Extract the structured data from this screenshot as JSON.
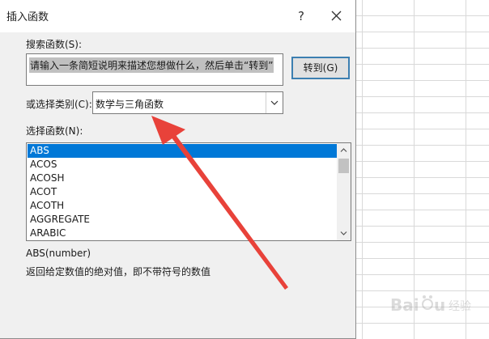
{
  "dialog": {
    "title": "插入函数",
    "help_glyph": "?",
    "search_label": "搜索函数(S):",
    "search_value": "请输入一条简短说明来描述您想做什么，然后单击“转到”",
    "goto_button": "转到(G)",
    "category_label": "或选择类别(C):",
    "category_value": "数学与三角函数",
    "function_list_label": "选择函数(N):",
    "functions": [
      {
        "name": "ABS",
        "selected": true
      },
      {
        "name": "ACOS",
        "selected": false
      },
      {
        "name": "ACOSH",
        "selected": false
      },
      {
        "name": "ACOT",
        "selected": false
      },
      {
        "name": "ACOTH",
        "selected": false
      },
      {
        "name": "AGGREGATE",
        "selected": false
      },
      {
        "name": "ARABIC",
        "selected": false
      }
    ],
    "signature": "ABS(number)",
    "description": "返回给定数值的绝对值，即不带符号的数值"
  },
  "colors": {
    "selection": "#0078d7",
    "annotation_arrow": "#e8423a",
    "button_border": "#3c7fb1"
  },
  "watermark": {
    "text": "Baidu 经验"
  }
}
